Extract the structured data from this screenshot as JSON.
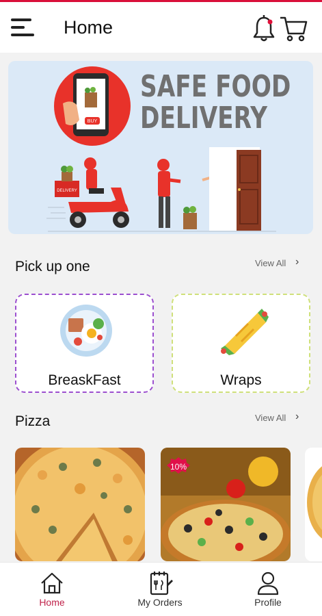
{
  "header": {
    "title": "Home",
    "icons": [
      "menu-icon",
      "bell-icon",
      "cart-icon"
    ],
    "accent_color": "#d9103a"
  },
  "banner": {
    "title_line1": "SAFE FOOD",
    "title_line2": "DELIVERY",
    "phone_button": "BUY",
    "scooter_box_label": "DELIVERY"
  },
  "categories_section": {
    "title": "Pick up one",
    "view_all": "View All",
    "items": [
      {
        "label": "BreaskFast",
        "icon": "breakfast-plate-icon",
        "border_color": "#9c4fcf"
      },
      {
        "label": "Wraps",
        "icon": "wrap-icon",
        "border_color": "#cfe07a"
      }
    ]
  },
  "pizza_section": {
    "title": "Pizza",
    "view_all": "View All",
    "items": [
      {
        "badge": ""
      },
      {
        "badge": "10%"
      },
      {
        "badge": ""
      }
    ]
  },
  "tabbar": {
    "items": [
      {
        "label": "Home",
        "icon": "home-icon",
        "active": true
      },
      {
        "label": "My Orders",
        "icon": "orders-icon",
        "active": false
      },
      {
        "label": "Profile",
        "icon": "profile-icon",
        "active": false
      }
    ],
    "active_color": "#c0224a"
  }
}
